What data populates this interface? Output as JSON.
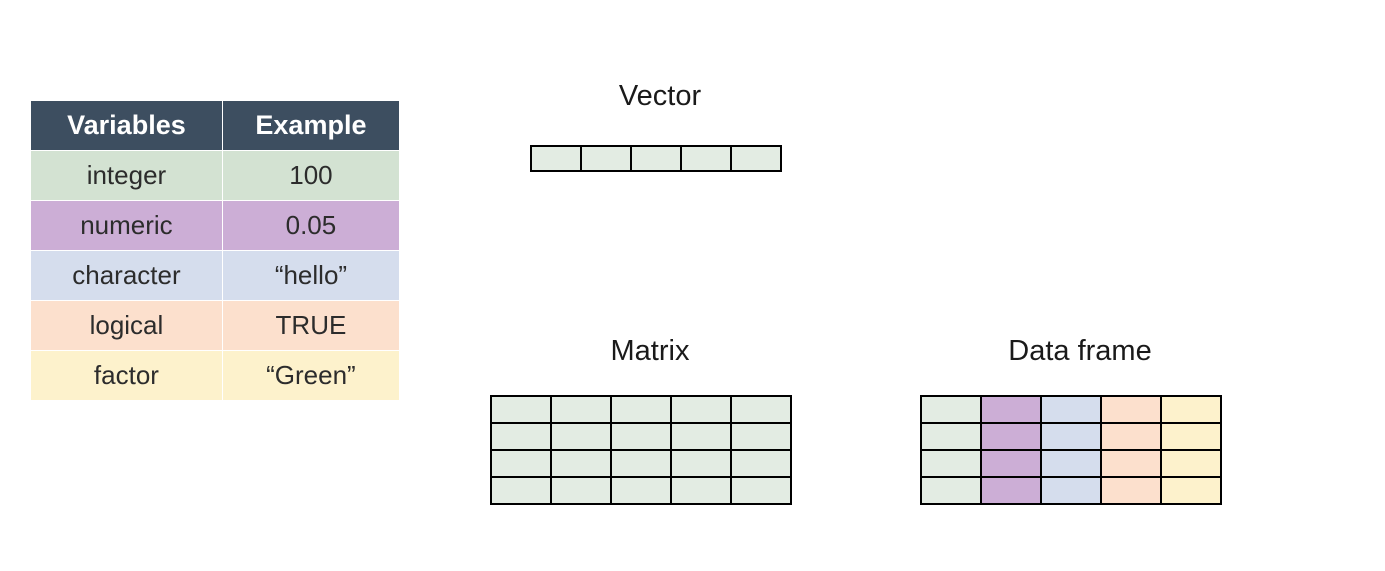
{
  "table": {
    "headers": {
      "variables": "Variables",
      "example": "Example"
    },
    "rows": [
      {
        "key": "integer",
        "variable": "integer",
        "example": "100"
      },
      {
        "key": "numeric",
        "variable": "numeric",
        "example": "0.05"
      },
      {
        "key": "character",
        "variable": "character",
        "example": "“hello”"
      },
      {
        "key": "logical",
        "variable": "logical",
        "example": "TRUE"
      },
      {
        "key": "factor",
        "variable": "factor",
        "example": "“Green”"
      }
    ]
  },
  "labels": {
    "vector": "Vector",
    "matrix": "Matrix",
    "dataframe": "Data frame"
  },
  "colors": {
    "header_bg": "#3d4e60",
    "integer": "#d3e2d2",
    "numeric": "#ccaed6",
    "character": "#d5dded",
    "logical": "#fce0cd",
    "factor": "#fdf2cc",
    "grid_fill": "#e3ece3"
  },
  "diagrams": {
    "vector": {
      "rows": 1,
      "cols": 5
    },
    "matrix": {
      "rows": 4,
      "cols": 5
    },
    "dataframe": {
      "rows": 4,
      "cols": 5
    }
  }
}
